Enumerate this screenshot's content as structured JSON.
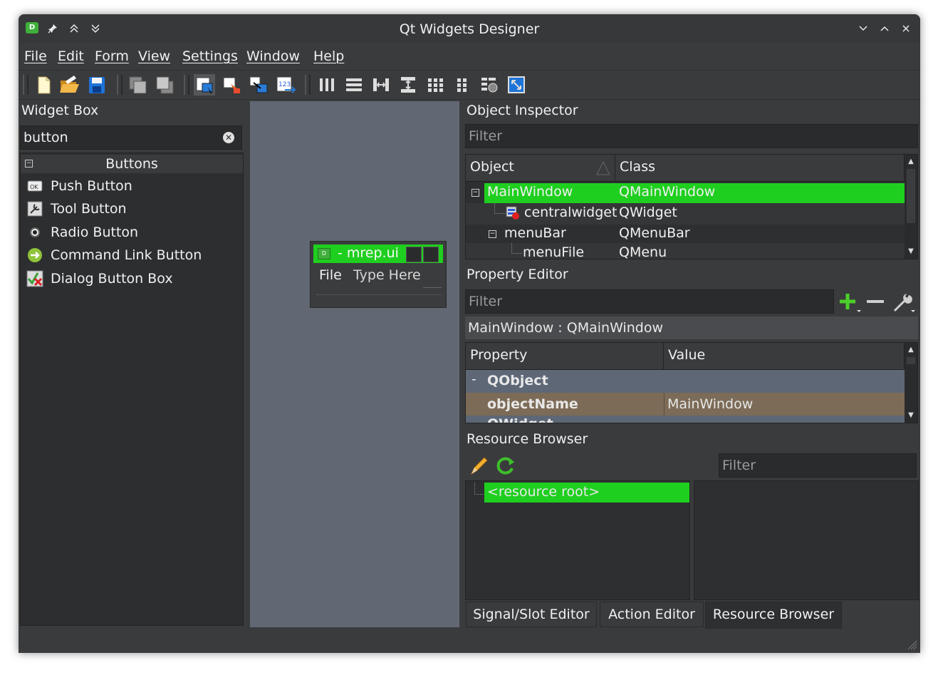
{
  "window": {
    "title": "Qt Widgets Designer",
    "app_icon_letter": "D",
    "left_controls": [
      "pin-icon",
      "keep-above-icon",
      "keep-below-icon"
    ],
    "right_controls": [
      "minimize-icon",
      "maximize-icon",
      "close-icon"
    ]
  },
  "menubar": {
    "items": [
      "File",
      "Edit",
      "Form",
      "View",
      "Settings",
      "Window",
      "Help"
    ]
  },
  "toolbar": {
    "groups": [
      [
        "new-form-icon",
        "open-form-icon",
        "save-form-icon"
      ],
      [
        "send-to-back-icon",
        "bring-to-front-icon"
      ],
      [
        "edit-widgets-icon",
        "edit-signals-slots-icon",
        "edit-buddies-icon",
        "edit-tab-order-icon"
      ],
      [
        "layout-horizontal-icon",
        "layout-vertical-icon",
        "layout-h-splitter-icon",
        "layout-v-splitter-icon",
        "layout-grid-icon",
        "layout-form-icon",
        "break-layout-icon",
        "adjust-size-icon"
      ]
    ]
  },
  "widget_box": {
    "title": "Widget Box",
    "search_value": "button",
    "category": "Buttons",
    "items": [
      {
        "label": "Push Button",
        "icon": "push-button-icon"
      },
      {
        "label": "Tool Button",
        "icon": "tool-button-icon"
      },
      {
        "label": "Radio Button",
        "icon": "radio-button-icon"
      },
      {
        "label": "Command Link Button",
        "icon": "command-link-icon"
      },
      {
        "label": "Dialog Button Box",
        "icon": "dialog-button-box-icon"
      }
    ]
  },
  "form_window": {
    "title": "- mrep.ui",
    "menu_file": "File",
    "menu_placeholder": "Type Here"
  },
  "object_inspector": {
    "title": "Object Inspector",
    "filter_placeholder": "Filter",
    "columns": [
      "Object",
      "Class"
    ],
    "rows": [
      {
        "object": "MainWindow",
        "class": "QMainWindow",
        "selected": true
      },
      {
        "object": "centralwidget",
        "class": "QWidget"
      },
      {
        "object": "menuBar",
        "class": "QMenuBar"
      },
      {
        "object": "menuFile",
        "class": "QMenu"
      }
    ]
  },
  "property_editor": {
    "title": "Property Editor",
    "filter_placeholder": "Filter",
    "context": "MainWindow : QMainWindow",
    "columns": [
      "Property",
      "Value"
    ],
    "group": "QObject",
    "property_name": "objectName",
    "property_value": "MainWindow",
    "partial_row": "QWidget"
  },
  "resource_browser": {
    "title": "Resource Browser",
    "filter_placeholder": "Filter",
    "root": "<resource root>"
  },
  "bottom_tabs": [
    "Signal/Slot Editor",
    "Action Editor",
    "Resource Browser"
  ],
  "colors": {
    "selection": "#1fcf1f",
    "property_row": "#7c6b57",
    "group_row": "#5d6776",
    "window_bg": "#3a3b3d"
  }
}
